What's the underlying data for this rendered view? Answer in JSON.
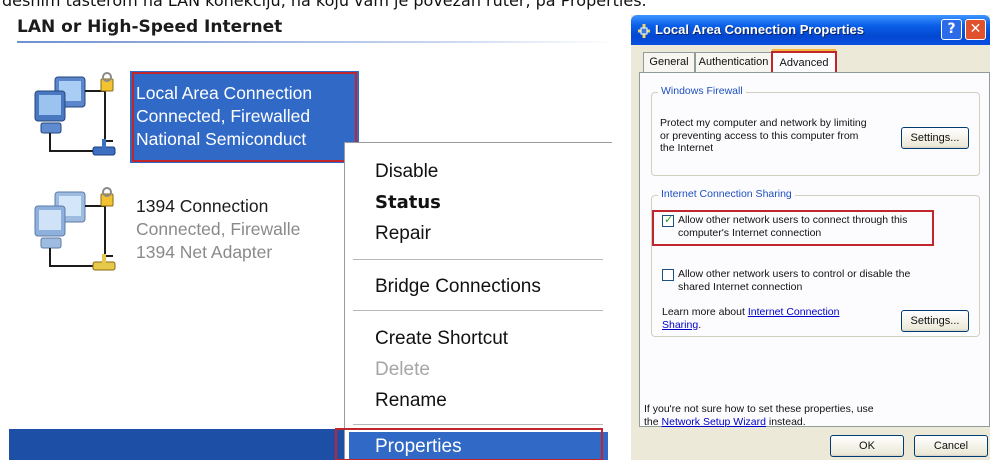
{
  "caption": "desnim tasterom na LAN konekciju, na koju vam je povezan ruter, pa Properties.",
  "explorer": {
    "section_title": "LAN or High-Speed Internet",
    "connections": [
      {
        "name": "Local Area Connection",
        "status": "Connected, Firewalled",
        "device": "National Semiconduct",
        "selected": true
      },
      {
        "name": "1394 Connection",
        "status": "Connected, Firewalle",
        "device": "1394 Net Adapter",
        "selected": false
      }
    ]
  },
  "context_menu": {
    "items": [
      {
        "label": "Disable"
      },
      {
        "label": "Status",
        "bold": true
      },
      {
        "label": "Repair"
      },
      {
        "label": "Bridge Connections"
      },
      {
        "label": "Create Shortcut"
      },
      {
        "label": "Delete",
        "disabled": true
      },
      {
        "label": "Rename"
      },
      {
        "label": "Properties",
        "selected": true
      }
    ]
  },
  "dialog": {
    "title": "Local Area Connection Properties",
    "help_glyph": "?",
    "close_glyph": "✕",
    "tabs": [
      {
        "label": "General",
        "active": false
      },
      {
        "label": "Authentication",
        "active": false
      },
      {
        "label": "Advanced",
        "active": true
      }
    ],
    "firewall_group": {
      "title": "Windows Firewall",
      "description_lines": [
        "Protect my computer and network by limiting",
        "or preventing access to this computer from",
        "the Internet"
      ],
      "settings_label": "Settings..."
    },
    "ics_group": {
      "title": "Internet Connection Sharing",
      "allow_connect_lines": [
        "Allow other network users to connect through this",
        "computer's Internet connection"
      ],
      "allow_connect_checked": true,
      "allow_control_lines": [
        "Allow other network users to control or disable the",
        "shared Internet connection"
      ],
      "allow_control_checked": false,
      "learn_more_prefix": "Learn more about ",
      "learn_more_link": "Internet Connection",
      "learn_more_link2": "Sharing",
      "learn_more_suffix": ".",
      "settings_label": "Settings..."
    },
    "footer_line1": "If you're not sure how to set these properties, use",
    "footer_prefix": "the ",
    "footer_link": "Network Setup Wizard",
    "footer_suffix": " instead.",
    "ok_label": "OK",
    "cancel_label": "Cancel"
  }
}
